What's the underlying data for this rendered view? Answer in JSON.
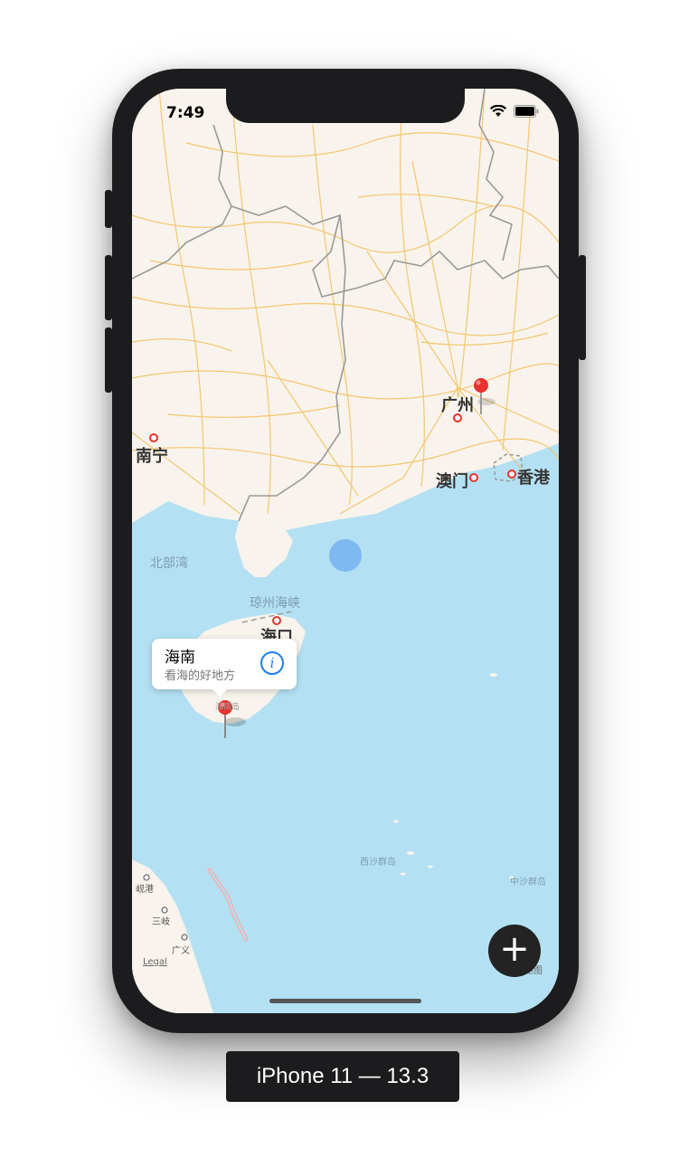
{
  "status_bar": {
    "time": "7:49"
  },
  "map": {
    "cities": [
      {
        "name": "广州"
      },
      {
        "name": "南宁"
      },
      {
        "name": "澳门"
      },
      {
        "name": "香港"
      },
      {
        "name": "海口"
      }
    ],
    "water_labels": {
      "beibu_gulf": "北部湾",
      "qiongzhou_strait": "琼州海峡",
      "xisha": "西沙群岛",
      "zhongsha": "中沙群岛"
    },
    "other_labels": {
      "hainan_island": "海南岛",
      "xianggang_small": "岘港",
      "sanqi": "三岐",
      "guangyi": "广义"
    },
    "legal": "Legal",
    "attribution": "高德地图"
  },
  "callout": {
    "title": "海南",
    "subtitle": "看海的好地方"
  },
  "fab": {
    "label": "+"
  },
  "device_label": "iPhone 11 — 13.3",
  "colors": {
    "land": "#f8f3ec",
    "sea": "#b3e1f3",
    "road": "#f4c363",
    "pin": "#e8322f",
    "user_location": "#74b3f0"
  }
}
